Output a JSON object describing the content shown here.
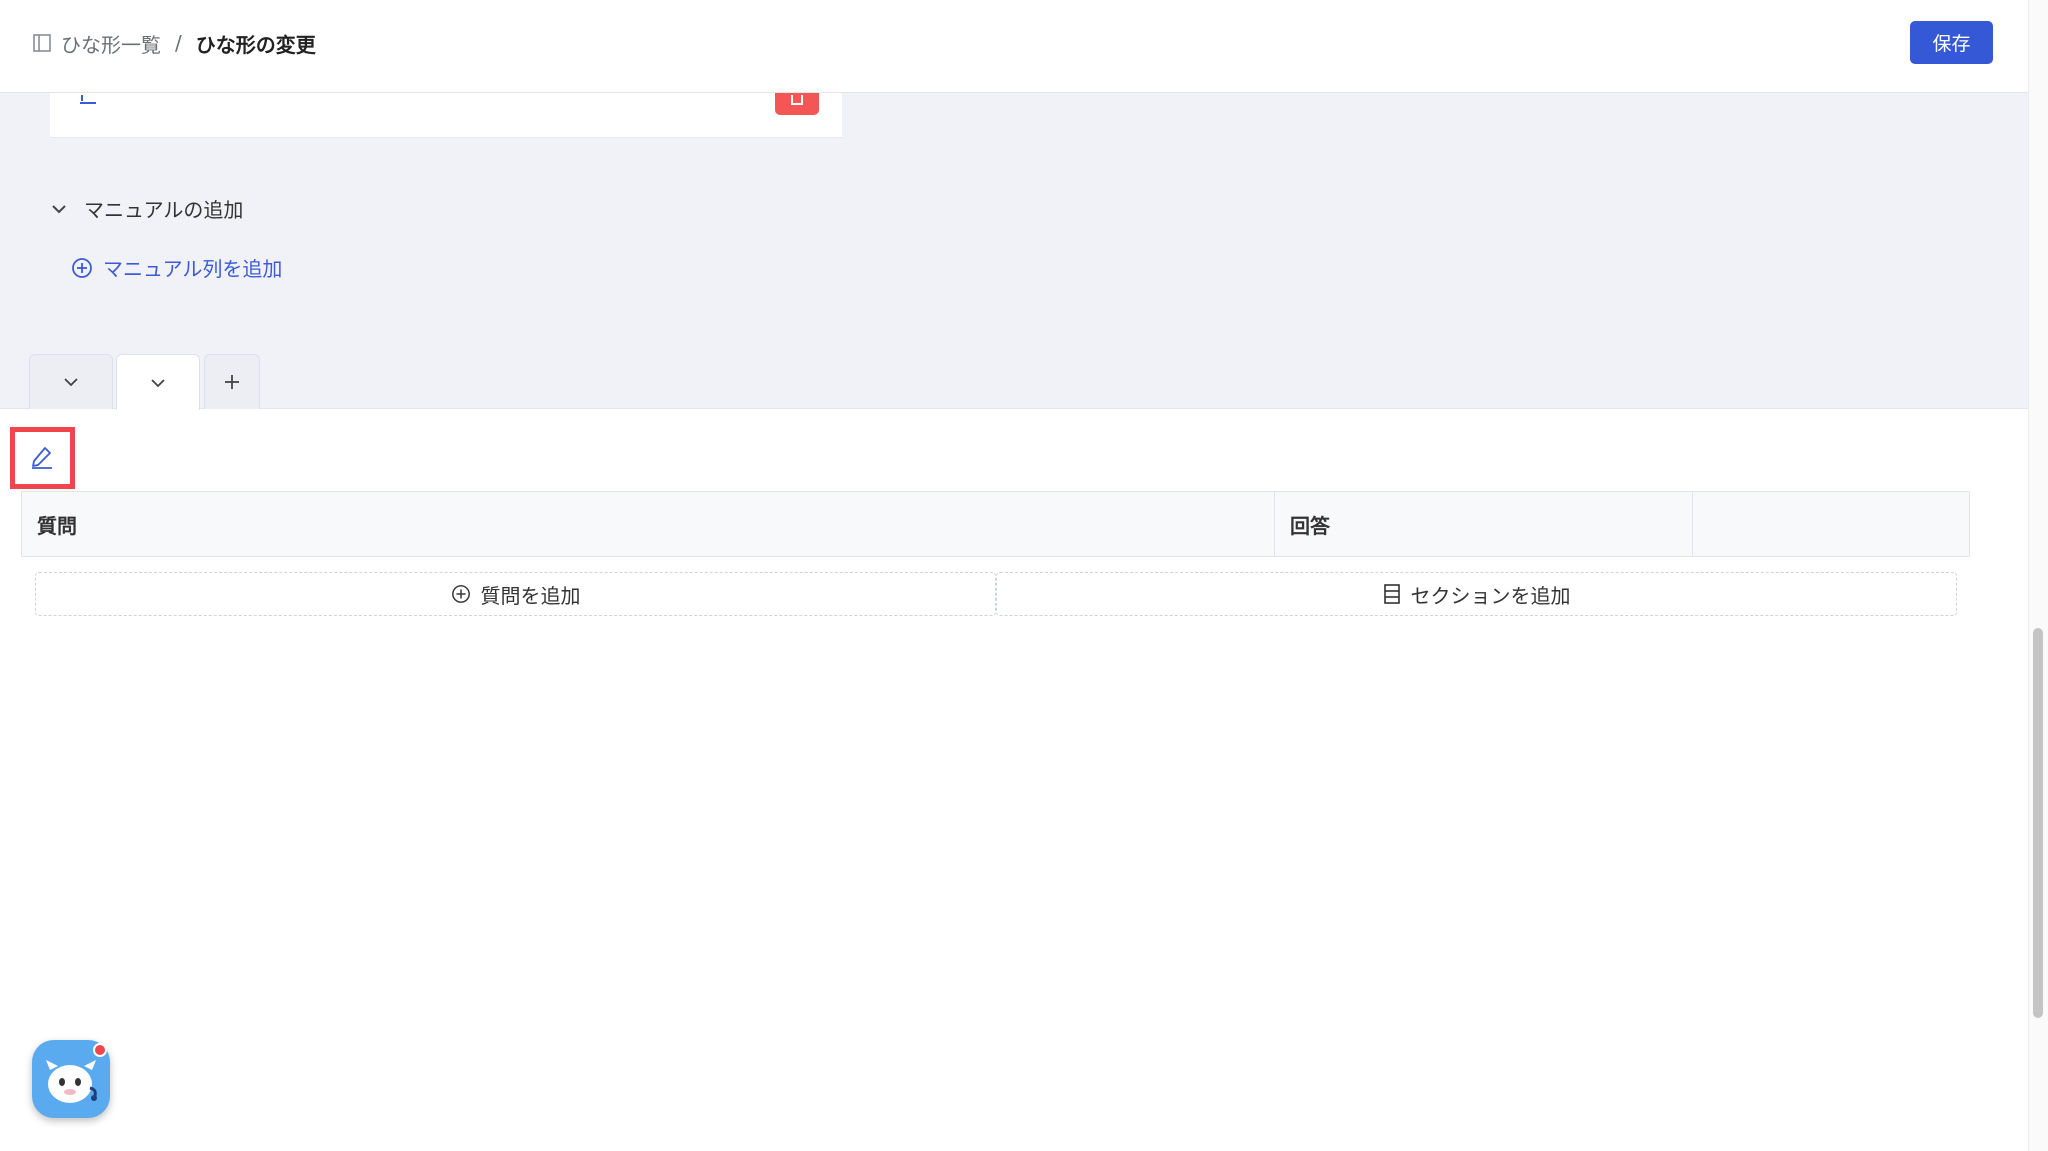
{
  "header": {
    "breadcrumb_parent": "ひな形一覧",
    "breadcrumb_separator": "/",
    "breadcrumb_current": "ひな形の変更",
    "save_label": "保存"
  },
  "manual_section": {
    "title": "マニュアルの追加",
    "add_column_label": "マニュアル列を追加"
  },
  "table": {
    "columns": [
      "質問",
      "回答",
      ""
    ]
  },
  "actions": {
    "add_question_label": "質問を追加",
    "add_section_label": "セクションを追加"
  },
  "colors": {
    "accent": "#3559d6",
    "link": "#3b5bd6",
    "danger": "#f45656",
    "highlight": "#f0454d",
    "grey_bg": "#f1f2f7"
  },
  "icons": [
    "panel-icon",
    "edit-icon",
    "trash-icon",
    "chevron-down-icon",
    "plus-circle-icon",
    "plus-icon",
    "pencil-icon",
    "section-icon",
    "chatbot-icon"
  ]
}
